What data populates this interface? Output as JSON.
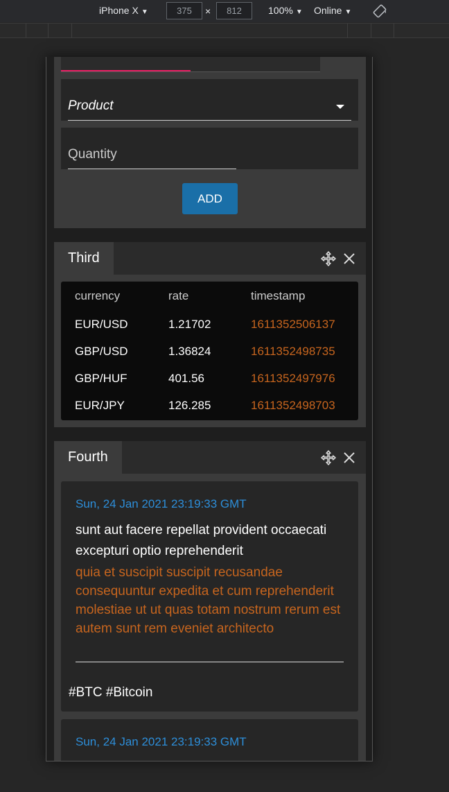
{
  "devtools": {
    "device": "iPhone X",
    "width": "375",
    "height": "812",
    "times": "×",
    "zoom": "100%",
    "network": "Online"
  },
  "form": {
    "progress_fraction": 0.5,
    "product_label": "Product",
    "quantity_label": "Quantity",
    "add_label": "ADD"
  },
  "third": {
    "tab_label": "Third",
    "columns": [
      "currency",
      "rate",
      "timestamp"
    ],
    "rows": [
      {
        "currency": "EUR/USD",
        "rate": "1.21702",
        "timestamp": "1611352506137"
      },
      {
        "currency": "GBP/USD",
        "rate": "1.36824",
        "timestamp": "1611352498735"
      },
      {
        "currency": "GBP/HUF",
        "rate": "401.56",
        "timestamp": "1611352497976"
      },
      {
        "currency": "EUR/JPY",
        "rate": "126.285",
        "timestamp": "1611352498703"
      }
    ]
  },
  "fourth": {
    "tab_label": "Fourth",
    "news": [
      {
        "date": "Sun, 24 Jan 2021 23:19:33 GMT",
        "title": "sunt aut facere repellat provident occaecati excepturi optio reprehenderit",
        "body": "quia et suscipit suscipit recusandae consequuntur expedita et cum reprehenderit molestiae ut ut quas totam nostrum rerum est autem sunt rem eveniet architecto",
        "tags": "#BTC #Bitcoin"
      },
      {
        "date": "Sun, 24 Jan 2021 23:19:33 GMT"
      }
    ]
  },
  "colors": {
    "accent_pink": "#e91e63",
    "button_blue": "#1a6fa8",
    "date_blue": "#2d8ed9",
    "orange": "#c7651e"
  }
}
